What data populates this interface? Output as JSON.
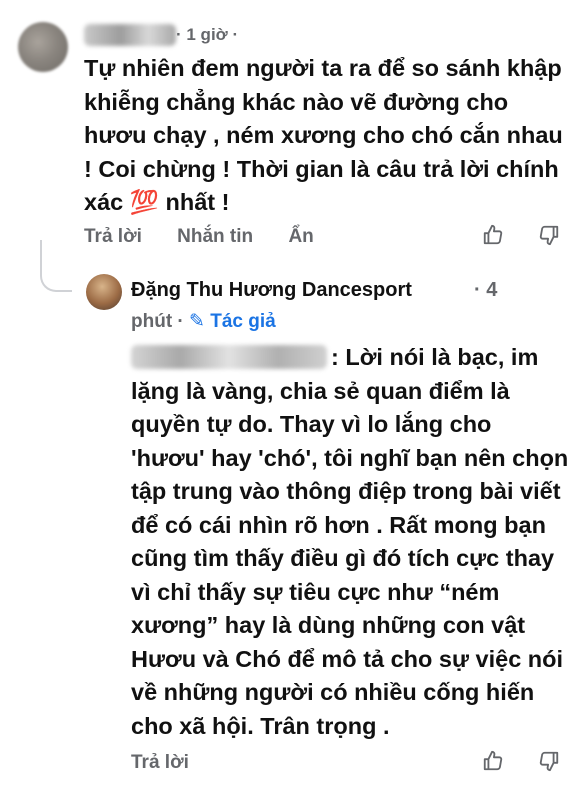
{
  "comment1": {
    "time": "· 1 giờ ·",
    "text": "Tự nhiên đem người ta ra để so sánh khập khiễng chẳng khác nào vẽ đường cho hươu chạy , ném xương cho chó cắn nhau  ! Coi chừng  ! Thời gian là câu trả lời chính xác 💯 nhất !",
    "actions": [
      "Trả lời",
      "Nhắn tin",
      "Ẩn"
    ],
    "icons": [
      "thumbs-up-icon",
      "thumbs-down-icon"
    ]
  },
  "reply": {
    "author": "Đặng Thu Hương Dancesport",
    "time_line1": "· 4",
    "time_line2": "phút ·",
    "author_badge": "✎ Tác giả",
    "text": ": Lời nói là bạc, im lặng là vàng, chia sẻ quan điểm là quyền tự do. Thay vì lo lắng cho 'hươu' hay 'chó', tôi nghĩ bạn nên chọn tập trung vào thông điệp trong bài viết để có cái nhìn rõ hơn . Rất mong bạn cũng tìm thấy điều gì đó tích cực thay vì chỉ thấy sự tiêu cực như “ném xương” hay là dùng những con vật Hươu và Chó để mô tả cho sự việc nói về những người có nhiều cống hiến cho xã hội. Trân trọng .",
    "action": "Trả lời"
  },
  "colors": {
    "secondary_text": "#65676b",
    "author_badge": "#1b74e4"
  }
}
